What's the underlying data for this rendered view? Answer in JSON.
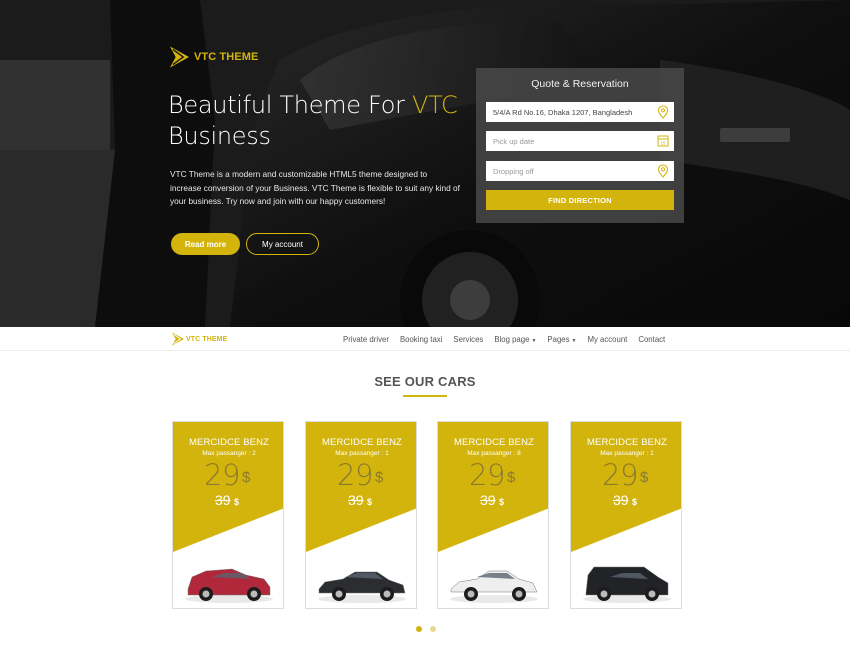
{
  "brand": {
    "name": "VTC THEME"
  },
  "hero": {
    "title_main": "Beautiful Theme For ",
    "title_accent": "VTC",
    "title_end": "Business",
    "description": "VTC Theme is a modern and customizable HTML5 theme designed to increase conversion of your Business. VTC Theme is flexible to suit any kind of your business. Try now and join with our happy customers!",
    "read_more": "Read more",
    "my_account": "My account"
  },
  "quote": {
    "title": "Quote & Reservation",
    "address_value": "5/4/A Rd No.16, Dhaka 1207, Bangladesh",
    "pickup_placeholder": "Pick up date",
    "dropoff_placeholder": "Dropping off",
    "button": "FIND DIRECTION",
    "date_icon_text": "15"
  },
  "nav": {
    "items": [
      {
        "label": "Private driver",
        "dropdown": false
      },
      {
        "label": "Booking taxi",
        "dropdown": false
      },
      {
        "label": "Services",
        "dropdown": false
      },
      {
        "label": "Blog page",
        "dropdown": true
      },
      {
        "label": "Pages",
        "dropdown": true
      },
      {
        "label": "My account",
        "dropdown": false
      },
      {
        "label": "Contact",
        "dropdown": false
      }
    ]
  },
  "cars_section": {
    "title": "SEE OUR CARS",
    "cars": [
      {
        "name": "MERCIDCE BENZ",
        "passengers": "Max passanger : 2",
        "price": "29",
        "currency": "$",
        "old_price": "39",
        "old_currency": "$",
        "car_color": "#b0283a",
        "car_type": "suv"
      },
      {
        "name": "MERCIDCE BENZ",
        "passengers": "Max passanger : 1",
        "price": "29",
        "currency": "$",
        "old_price": "39",
        "old_currency": "$",
        "car_color": "#2b2d31",
        "car_type": "sedan"
      },
      {
        "name": "MERCIDCE BENZ",
        "passengers": "Max passanger : 8",
        "price": "29",
        "currency": "$",
        "old_price": "39",
        "old_currency": "$",
        "car_color": "#eeeeee",
        "car_type": "coupe"
      },
      {
        "name": "MERCIDCE BENZ",
        "passengers": "Max passanger : 1",
        "price": "29",
        "currency": "$",
        "old_price": "39",
        "old_currency": "$",
        "car_color": "#222326",
        "car_type": "van"
      }
    ]
  },
  "slider": {
    "dots": 2,
    "active": 0
  },
  "colors": {
    "accent": "#d3b40c",
    "price_text": "#8a7a2e"
  },
  "icons": {
    "location": "location-pin-icon",
    "calendar": "calendar-icon",
    "brand": "brand-chevron-icon"
  }
}
